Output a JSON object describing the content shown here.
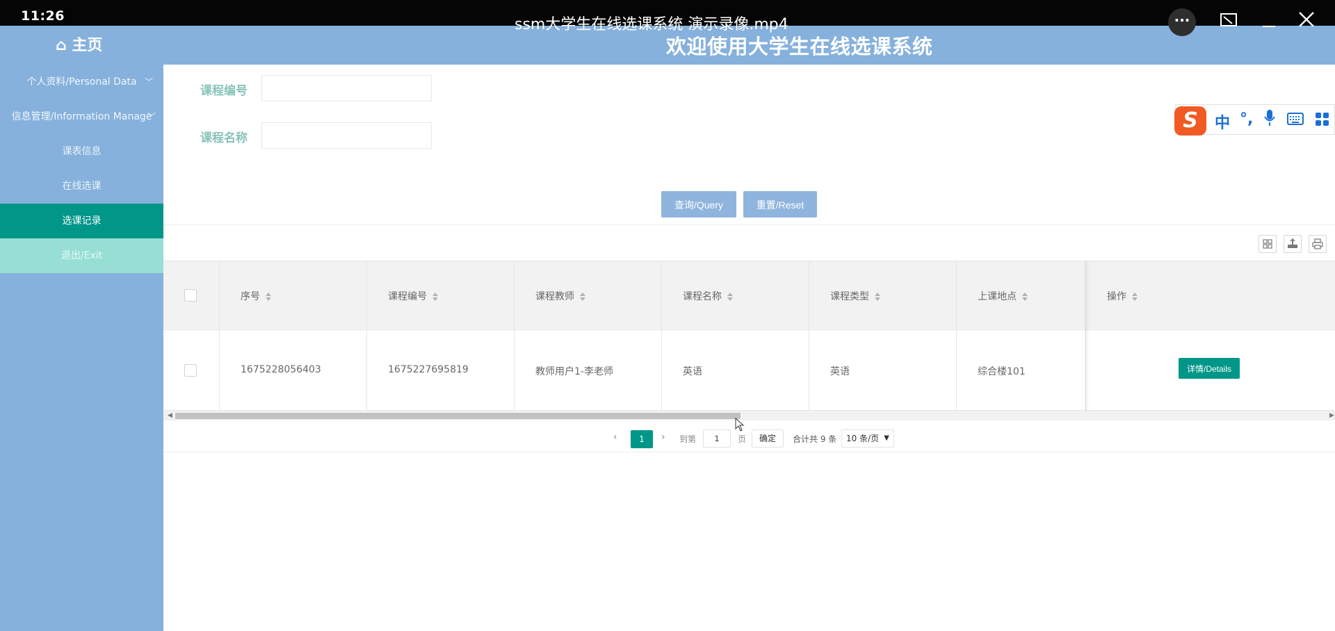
{
  "player": {
    "time": "11:26",
    "title": "ssm大学生在线选课系统 演示录像.mp4",
    "more_label": "···"
  },
  "header": {
    "home_label": "⌂ 主页",
    "title": "欢迎使用大学生在线选课系统"
  },
  "sidebar": {
    "items": [
      {
        "label": "个人资料/Personal Data"
      },
      {
        "label": "信息管理/Information Manage"
      },
      {
        "label": "课表信息"
      },
      {
        "label": "在线选课"
      },
      {
        "label": "选课记录"
      },
      {
        "label": "退出/Exit"
      }
    ]
  },
  "search": {
    "course_no_label": "课程编号",
    "course_no_value": "",
    "course_name_label": "课程名称",
    "course_name_value": "",
    "query_label": "查询/Query",
    "reset_label": "重置/Reset"
  },
  "ime": {
    "logo": "S",
    "zh": "中",
    "punct": "°,"
  },
  "table": {
    "columns": [
      "序号",
      "课程编号",
      "课程教师",
      "课程名称",
      "课程类型",
      "上课地点",
      "操作"
    ],
    "rows": [
      {
        "id": "1675228056403",
        "course_no": "1675227695819",
        "teacher": "教师用户1-李老师",
        "course_name": "英语",
        "course_type": "英语",
        "location": "综合楼101",
        "action": "详情/Details"
      }
    ]
  },
  "pagination": {
    "current_page": "1",
    "goto_label": "到第",
    "goto_value": "1",
    "page_unit": "页",
    "confirm_label": "确定",
    "total_label": "合计共 9 条",
    "page_size": "10 条/页"
  },
  "colors": {
    "accent": "#009688",
    "header_bg": "#86b1dc",
    "button_bg": "#8fb4dd"
  }
}
